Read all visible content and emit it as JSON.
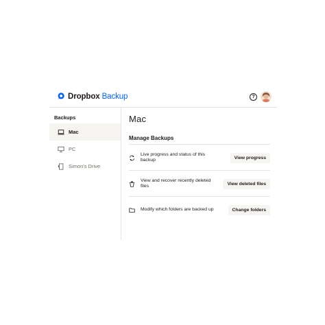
{
  "header": {
    "brand": "Dropbox",
    "product": "Backup",
    "help_icon": "question-circle-icon",
    "help_glyph": "?",
    "avatar_icon": "user-avatar"
  },
  "sidebar": {
    "title": "Backups",
    "items": [
      {
        "label": "Mac",
        "icon": "laptop-icon",
        "active": true
      },
      {
        "label": "PC",
        "icon": "desktop-icon",
        "active": false
      },
      {
        "label": "Simon's Drive",
        "icon": "external-drive-icon",
        "active": false
      }
    ]
  },
  "main": {
    "title": "Mac",
    "section_title": "Manage Backups",
    "rows": [
      {
        "icon": "sync-icon",
        "text": "Live progress and status of this backup",
        "button": "View progress"
      },
      {
        "icon": "trash-icon",
        "text": "View and recover recently deleted files",
        "button": "View deleted files"
      },
      {
        "icon": "folder-icon",
        "text": "Modify which folders are backed up",
        "button": "Change folders"
      }
    ]
  },
  "colors": {
    "accent": "#0061fe",
    "text": "#1e1919",
    "muted": "#736c64",
    "selected_bg": "#f7f5f2",
    "border": "#e7e4df"
  }
}
